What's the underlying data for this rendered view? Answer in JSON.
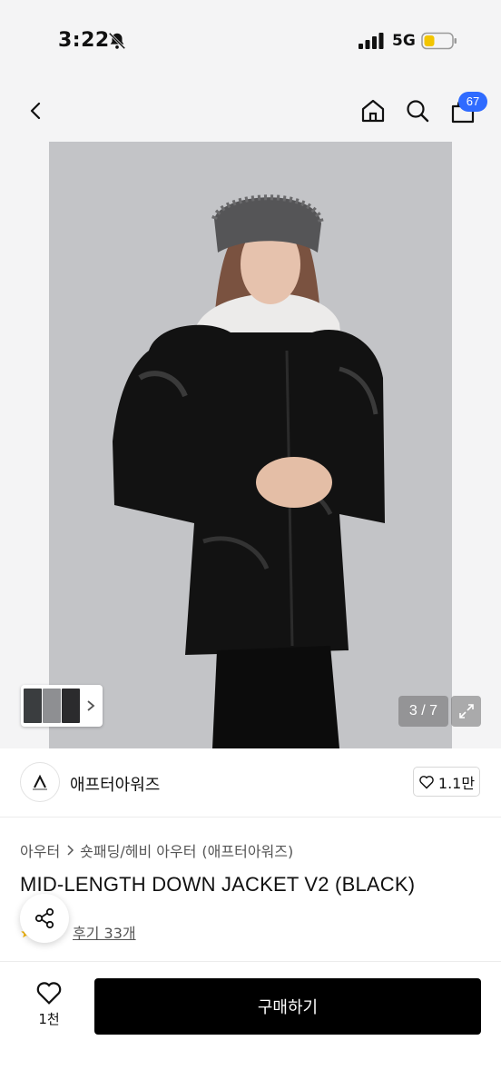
{
  "status": {
    "time": "3:22",
    "network": "5G"
  },
  "nav": {
    "cart_count": "67"
  },
  "gallery": {
    "counter": "3 / 7",
    "background": "#c4c5c8"
  },
  "brand": {
    "name": "애프터아워즈",
    "likes": "1.1만"
  },
  "breadcrumb": {
    "items": [
      "아우터",
      "숏패딩/헤비 아우터",
      "(애프터아워즈)"
    ]
  },
  "product": {
    "title": "MID-LENGTH DOWN JACKET V2 (BLACK)",
    "review_text": "후기 33개"
  },
  "bottom": {
    "wish_count": "1천",
    "buy_label": "구매하기"
  },
  "colors": {
    "accent_badge": "#2f6bff",
    "buy_button": "#000000",
    "star": "#f5b400"
  }
}
